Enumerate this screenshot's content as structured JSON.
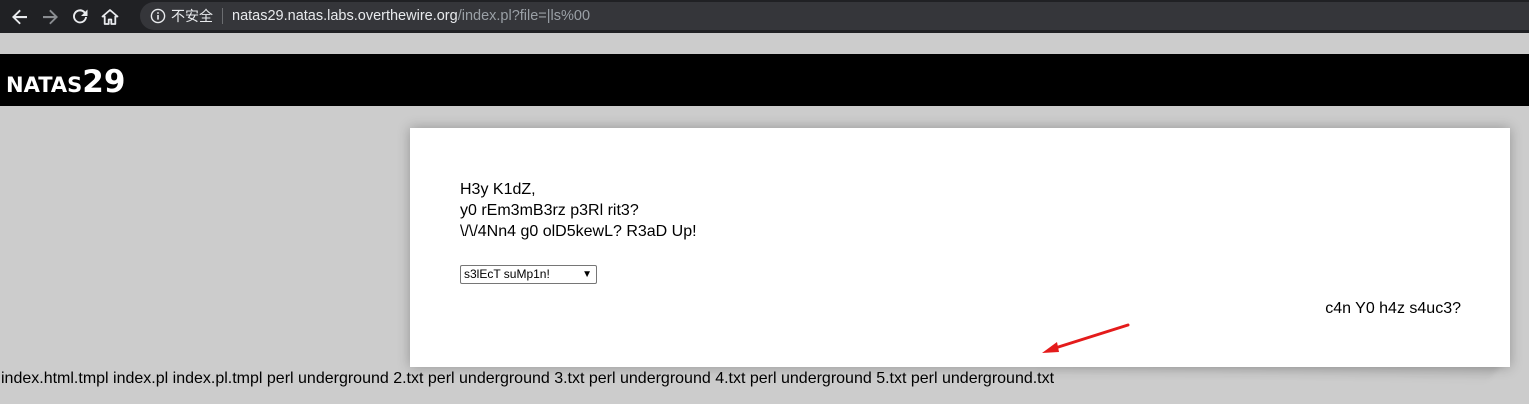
{
  "browser": {
    "security_label": "不安全",
    "url_host": "natas29.natas.labs.overthewire.org",
    "url_path": "/index.pl?file=|ls%00"
  },
  "page": {
    "title_prefix": "NATAS",
    "title_number": "29",
    "message_lines": [
      "H3y K1dZ,",
      "y0 rEm3mB3rz p3Rl rit3?",
      "\\/\\/4Nn4 g0 olD5kewL? R3aD Up!"
    ],
    "select_value": "s3lEcT suMp1n!",
    "hack_prompt": "c4n Y0 h4z s4uc3?",
    "file_listing": "index.html.tmpl index.pl index.pl.tmpl perl underground 2.txt perl underground 3.txt perl underground 4.txt perl underground 5.txt perl underground.txt"
  },
  "colors": {
    "chrome_bg": "#202124",
    "omnibox_bg": "#35363a",
    "page_bg": "#cccccc",
    "header_bg": "#000000",
    "annotation_arrow": "#e41b1b"
  }
}
